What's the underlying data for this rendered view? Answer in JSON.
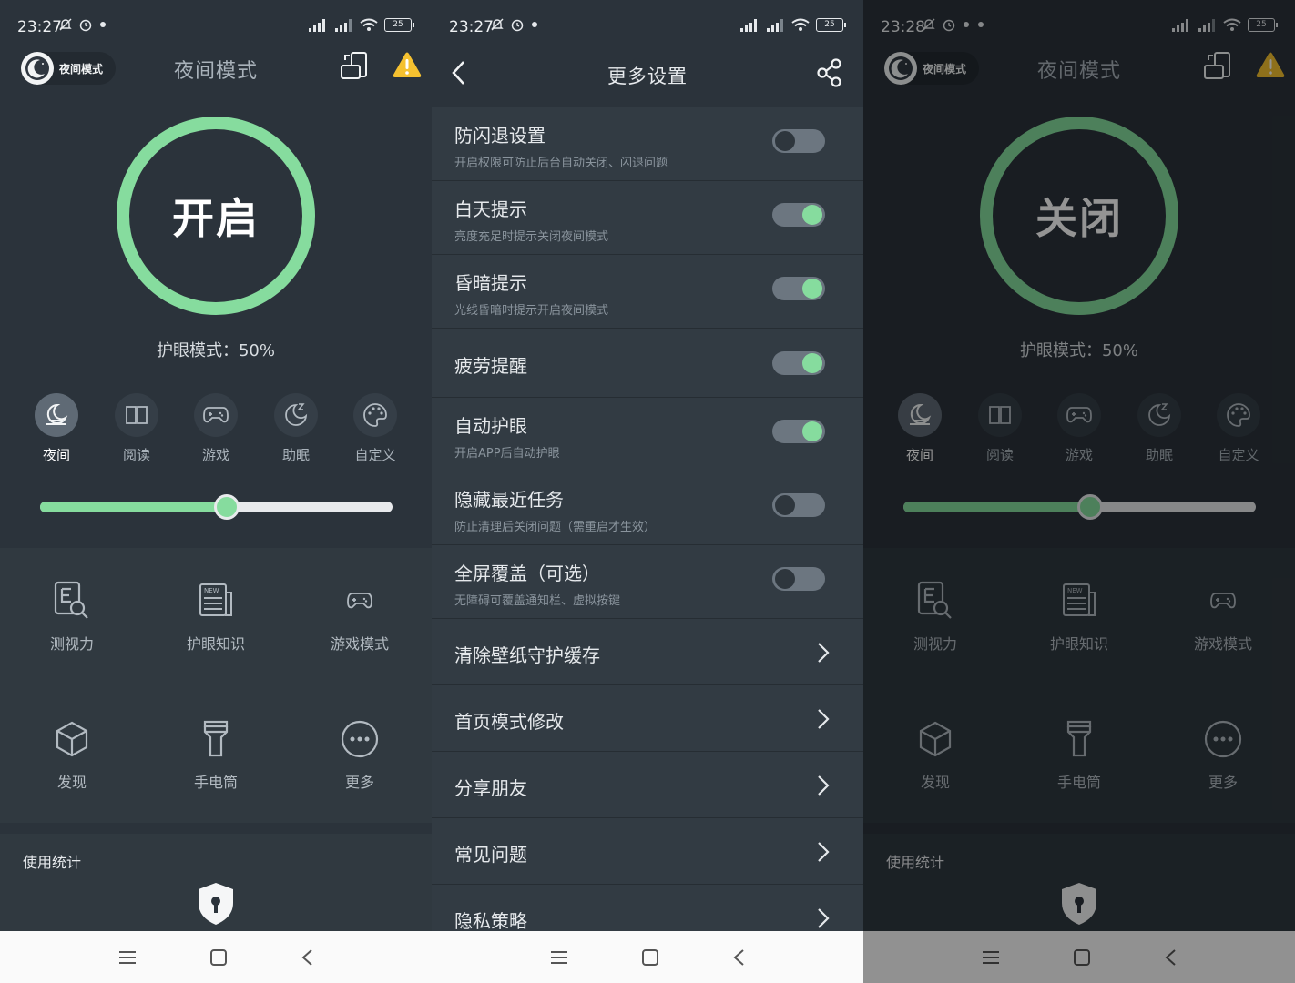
{
  "colors": {
    "accent": "#86dc9e",
    "bg": "#2b333b",
    "panel": "#303940",
    "warning": "#f5c130"
  },
  "screens": [
    {
      "status": {
        "time": "23:27",
        "battery": "25"
      },
      "header": {
        "pill_label": "夜间模式",
        "title": "夜间模式"
      },
      "ring": {
        "label": "开启"
      },
      "eye_mode": "护眼模式：50%",
      "slider": {
        "value_pct": 53
      },
      "modes": [
        {
          "label": "夜间",
          "icon": "night-icon",
          "active": true
        },
        {
          "label": "阅读",
          "icon": "book-icon",
          "active": false
        },
        {
          "label": "游戏",
          "icon": "gamepad-icon",
          "active": false
        },
        {
          "label": "助眠",
          "icon": "sleep-moon-icon",
          "active": false
        },
        {
          "label": "自定义",
          "icon": "palette-icon",
          "active": false
        }
      ],
      "grid": [
        {
          "label": "测视力",
          "icon": "eye-test-icon"
        },
        {
          "label": "护眼知识",
          "icon": "news-icon"
        },
        {
          "label": "游戏模式",
          "icon": "gamepad-icon"
        },
        {
          "label": "发现",
          "icon": "cube-icon"
        },
        {
          "label": "手电筒",
          "icon": "flashlight-icon"
        },
        {
          "label": "更多",
          "icon": "more-icon"
        }
      ],
      "stats_title": "使用统计"
    },
    {
      "status": {
        "time": "23:27",
        "battery": "25"
      },
      "header": {
        "title": "更多设置"
      },
      "rows": [
        {
          "title": "防闪退设置",
          "sub": "开启权限可防止后台自动关闭、闪退问题",
          "type": "toggle",
          "on": false
        },
        {
          "title": "白天提示",
          "sub": "亮度充足时提示关闭夜间模式",
          "type": "toggle",
          "on": true
        },
        {
          "title": "昏暗提示",
          "sub": "光线昏暗时提示开启夜间模式",
          "type": "toggle",
          "on": true
        },
        {
          "title": "疲劳提醒",
          "sub": "",
          "type": "toggle",
          "on": true
        },
        {
          "title": "自动护眼",
          "sub": "开启APP后自动护眼",
          "type": "toggle",
          "on": true
        },
        {
          "title": "隐藏最近任务",
          "sub": "防止清理后关闭问题（需重启才生效）",
          "type": "toggle",
          "on": false
        },
        {
          "title": "全屏覆盖（可选）",
          "sub": "无障碍可覆盖通知栏、虚拟按键",
          "type": "toggle",
          "on": false
        },
        {
          "title": "清除壁纸守护缓存",
          "sub": "",
          "type": "link"
        },
        {
          "title": "首页模式修改",
          "sub": "",
          "type": "link"
        },
        {
          "title": "分享朋友",
          "sub": "",
          "type": "link"
        },
        {
          "title": "常见问题",
          "sub": "",
          "type": "link"
        },
        {
          "title": "隐私策略",
          "sub": "",
          "type": "link"
        }
      ]
    },
    {
      "status": {
        "time": "23:28",
        "battery": "25"
      },
      "header": {
        "pill_label": "夜间模式",
        "title": "夜间模式"
      },
      "ring": {
        "label": "关闭"
      },
      "eye_mode": "护眼模式：50%",
      "slider": {
        "value_pct": 53
      },
      "modes": [
        {
          "label": "夜间",
          "icon": "night-icon",
          "active": true
        },
        {
          "label": "阅读",
          "icon": "book-icon",
          "active": false
        },
        {
          "label": "游戏",
          "icon": "gamepad-icon",
          "active": false
        },
        {
          "label": "助眠",
          "icon": "sleep-moon-icon",
          "active": false
        },
        {
          "label": "自定义",
          "icon": "palette-icon",
          "active": false
        }
      ],
      "grid": [
        {
          "label": "测视力",
          "icon": "eye-test-icon"
        },
        {
          "label": "护眼知识",
          "icon": "news-icon"
        },
        {
          "label": "游戏模式",
          "icon": "gamepad-icon"
        },
        {
          "label": "发现",
          "icon": "cube-icon"
        },
        {
          "label": "手电筒",
          "icon": "flashlight-icon"
        },
        {
          "label": "更多",
          "icon": "more-icon"
        }
      ],
      "stats_title": "使用统计"
    }
  ]
}
